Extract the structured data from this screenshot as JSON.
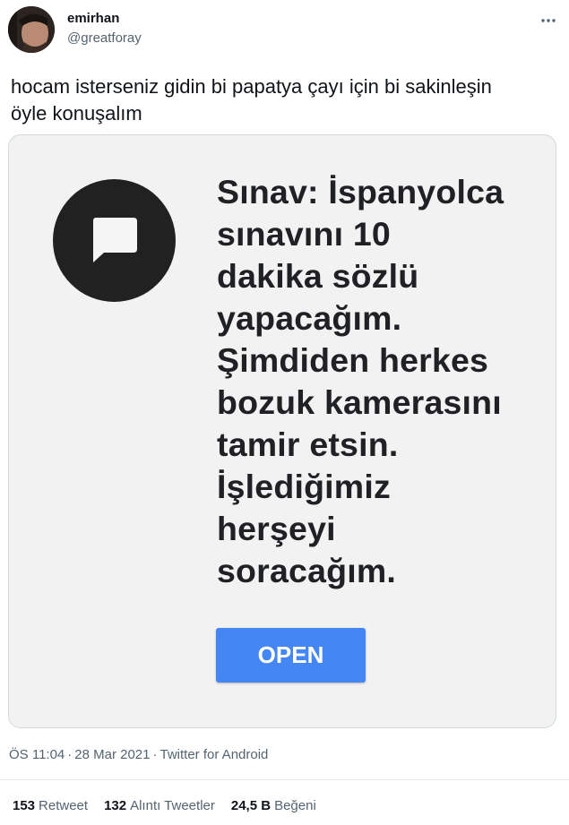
{
  "user": {
    "display_name": "emirhan",
    "handle": "@greatforay"
  },
  "tweet": {
    "text_line1": "hocam isterseniz gidin bi papatya çayı için bi sakinleşin",
    "text_line2": "öyle konuşalım"
  },
  "card": {
    "message_lines": [
      "Sınav: İspanyolca",
      "sınavını 10",
      "dakika sözlü",
      "yapacağım.",
      "Şimdiden herkes",
      "bozuk kamerasını",
      "tamir etsin.",
      "İşlediğimiz",
      "herşeyi",
      "soracağım."
    ],
    "button_label": "OPEN",
    "icon": "chat-bubble-icon",
    "button_color": "#4386f4",
    "circle_color": "#212121"
  },
  "meta": {
    "time": "ÖS 11:04",
    "date": "28 Mar 2021",
    "source": "Twitter for Android"
  },
  "stats": {
    "retweets_count": "153",
    "retweets_label": "Retweet",
    "quotes_count": "132",
    "quotes_label": "Alıntı Tweetler",
    "likes_count": "24,5 B",
    "likes_label": "Beğeni"
  },
  "icons": {
    "more": "more-horizontal-icon",
    "avatar": "avatar"
  }
}
